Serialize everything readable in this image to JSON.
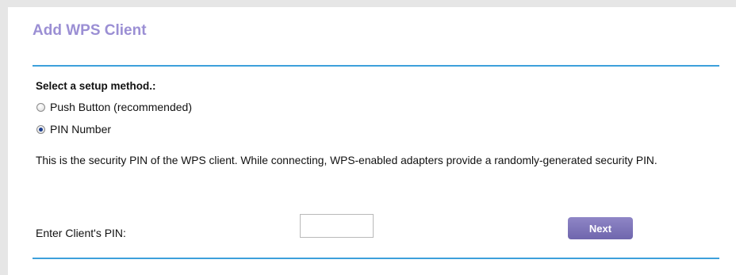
{
  "header": {
    "title": "Add WPS Client"
  },
  "setup": {
    "label": "Select a setup method.:",
    "options": [
      {
        "label": "Push Button (recommended)",
        "selected": false
      },
      {
        "label": "PIN Number",
        "selected": true
      }
    ]
  },
  "description": "This is the security PIN of the WPS client. While connecting, WPS-enabled adapters provide a randomly-generated security PIN.",
  "pin": {
    "label": "Enter Client's PIN:",
    "value": "",
    "placeholder": ""
  },
  "actions": {
    "next_label": "Next"
  },
  "colors": {
    "title": "#9b8fd4",
    "rule": "#3da0db",
    "button": "#7a71b6"
  }
}
